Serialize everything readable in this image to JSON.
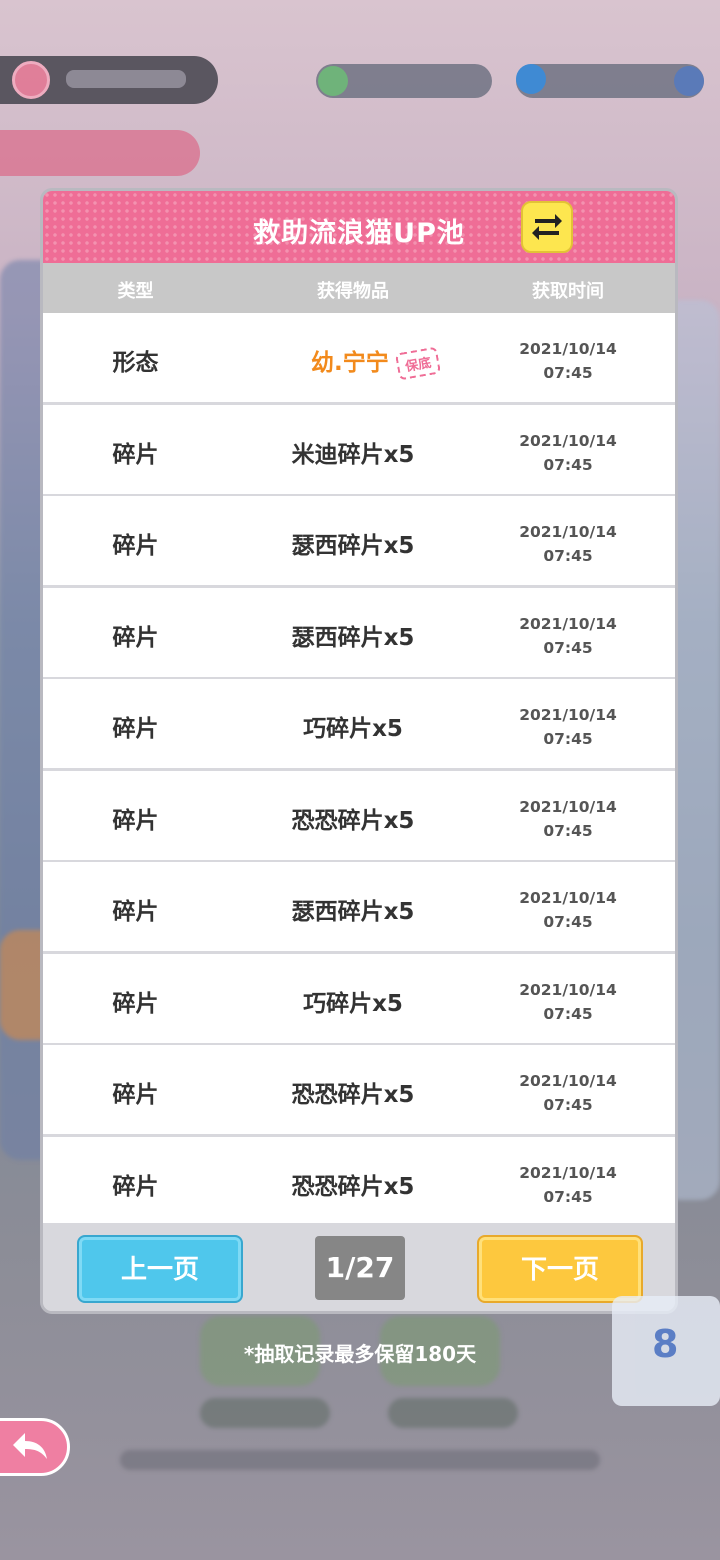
{
  "dialog": {
    "title": "救助流浪猫UP池",
    "swap_icon": "swap-arrows-icon",
    "columns": [
      "类型",
      "获得物品",
      "获取时间"
    ],
    "rows": [
      {
        "type": "形态",
        "item": "幼.宁宁",
        "stamp": "保底",
        "date": "2021/10/14",
        "time": "07:45"
      },
      {
        "type": "碎片",
        "item": "米迪碎片x5",
        "date": "2021/10/14",
        "time": "07:45"
      },
      {
        "type": "碎片",
        "item": "瑟西碎片x5",
        "date": "2021/10/14",
        "time": "07:45"
      },
      {
        "type": "碎片",
        "item": "瑟西碎片x5",
        "date": "2021/10/14",
        "time": "07:45"
      },
      {
        "type": "碎片",
        "item": "巧碎片x5",
        "date": "2021/10/14",
        "time": "07:45"
      },
      {
        "type": "碎片",
        "item": "恐恐碎片x5",
        "date": "2021/10/14",
        "time": "07:45"
      },
      {
        "type": "碎片",
        "item": "瑟西碎片x5",
        "date": "2021/10/14",
        "time": "07:45"
      },
      {
        "type": "碎片",
        "item": "巧碎片x5",
        "date": "2021/10/14",
        "time": "07:45"
      },
      {
        "type": "碎片",
        "item": "恐恐碎片x5",
        "date": "2021/10/14",
        "time": "07:45"
      },
      {
        "type": "碎片",
        "item": "恐恐碎片x5",
        "date": "2021/10/14",
        "time": "07:45"
      }
    ],
    "prev_label": "上一页",
    "next_label": "下一页",
    "page_indicator": "1/27"
  },
  "note": "*抽取记录最多保留180天",
  "background": {
    "badge_number": "8"
  },
  "back_icon": "back-arrow-icon",
  "colors": {
    "header_pink": "#ef6d96",
    "prev_blue": "#4fc7ec",
    "next_yellow": "#fdc83e",
    "special_orange": "#f28a1c"
  }
}
